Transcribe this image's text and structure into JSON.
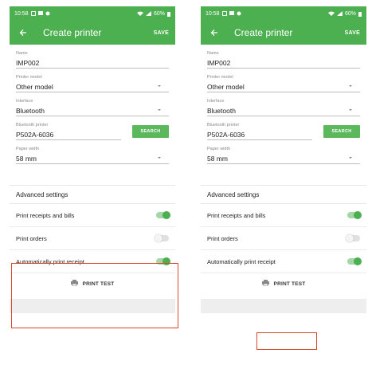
{
  "screens": [
    {
      "status": {
        "time": "10:58",
        "battery": "60%"
      },
      "app_bar": {
        "title": "Create printer",
        "save": "SAVE"
      },
      "fields": {
        "name": {
          "label": "Name",
          "value": "IMP002"
        },
        "printer_model": {
          "label": "Printer model",
          "value": "Other model"
        },
        "interface": {
          "label": "Interface",
          "value": "Bluetooth"
        },
        "bluetooth_printer": {
          "label": "Bluetooth printer",
          "value": "P502A-6036"
        },
        "paper_width": {
          "label": "Paper width",
          "value": "58 mm"
        }
      },
      "search_button": "SEARCH",
      "advanced_title": "Advanced settings",
      "switches": [
        {
          "label": "Print receipts and bills",
          "on": true
        },
        {
          "label": "Print orders",
          "on": false
        },
        {
          "label": "Automatically print receipt",
          "on": true
        }
      ],
      "print_test": "PRINT TEST"
    },
    {
      "status": {
        "time": "10:58",
        "battery": "60%"
      },
      "app_bar": {
        "title": "Create printer",
        "save": "SAVE"
      },
      "fields": {
        "name": {
          "label": "Name",
          "value": "IMP002"
        },
        "printer_model": {
          "label": "Printer model",
          "value": "Other model"
        },
        "interface": {
          "label": "Interface",
          "value": "Bluetooth"
        },
        "bluetooth_printer": {
          "label": "Bluetooth printer",
          "value": "P502A-6036"
        },
        "paper_width": {
          "label": "Paper width",
          "value": "58 mm"
        }
      },
      "search_button": "SEARCH",
      "advanced_title": "Advanced settings",
      "switches": [
        {
          "label": "Print receipts and bills",
          "on": true
        },
        {
          "label": "Print orders",
          "on": false
        },
        {
          "label": "Automatically print receipt",
          "on": true
        }
      ],
      "print_test": "PRINT TEST"
    }
  ],
  "colors": {
    "primary": "#4caf50",
    "highlight": "#d84a2e",
    "search_button": "#5cb85c"
  }
}
